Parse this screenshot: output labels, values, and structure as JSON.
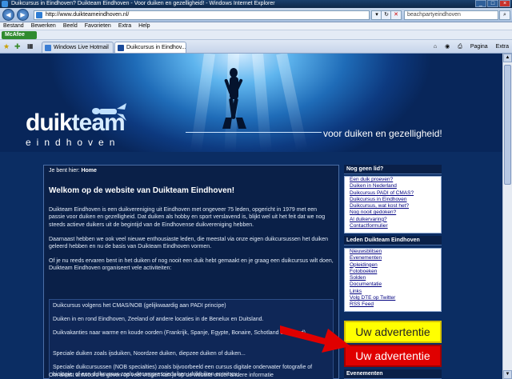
{
  "window": {
    "title": "Duikcursus in Eindhoven? Duikteam Eindhoven - Voor duiken en gezelligheid! - Windows Internet Explorer"
  },
  "addressbar": {
    "url": "http://www.duikteameindhoven.nl/",
    "search_text": "beachpartyeindhoven"
  },
  "menubar": {
    "items": [
      "Bestand",
      "Bewerken",
      "Beeld",
      "Favorieten",
      "Extra",
      "Help"
    ]
  },
  "linksbar": {
    "mcafee": "McAfee"
  },
  "tabs": [
    {
      "label": "Windows Live Hotmail",
      "active": false
    },
    {
      "label": "Duikcursus in Eindhov...",
      "active": true
    }
  ],
  "toolbar": {
    "page": "Pagina",
    "extra": "Extra"
  },
  "banner": {
    "logo_main": "duik",
    "logo_team": "team",
    "logo_sub": "eindhoven",
    "slogan": "voor duiken en gezelligheid!"
  },
  "content": {
    "breadcrumb_prefix": "Je bent hier: ",
    "breadcrumb_home": "Home",
    "heading": "Welkom op de website van Duikteam Eindhoven!",
    "para1": "Duikteam Eindhoven is een duikvereniging uit Eindhoven met ongeveer 75 leden, opgericht in 1979 met een passie voor duiken en gezelligheid. Dat duiken als hobby en sport verslavend is, blijkt wel uit het feit dat we nog steeds actieve duikers uit de begintijd van de Eindhovense duikvereniging hebben.",
    "para2": "Daarnaast hebben we ook veel nieuwe enthousiaste leden, die meestal via onze eigen duikcursussen het duiken geleerd hebben en nu de basis van Duikteam Eindhoven vormen.",
    "para3": "Of je nu reeds ervaren bent in het duiken of nog nooit een duik hebt gemaakt en je graag een duikcursus wilt doen, Duikteam Eindhoven organiseert vele activiteiten:",
    "activities": [
      "Duikcursus volgens het CMAS/NOB (gelijkwaardig aan PADI principe)",
      "Duiken in en rond Eindhoven, Zeeland of andere locaties in de Benelux en Duitsland.",
      "Duikvakanties naar warme en koude oorden (Frankrijk, Spanje, Egypte, Bonaire, Schotland of Ierland)",
      "Speciale duiken zoals ijsduiken, Noordzee duiken, diepzee duiken of duiken...",
      "Speciale duikcursussen (NOB specialties) zoals bijvoorbeeld een cursus digitale onderwater fotografie of biologie, of een duikcursus zoals decompressieduiken, drifduiken en nitrox."
    ],
    "para4": "Om alvast antwoord te geven op veel vragen kan je op de website onder andere informatie"
  },
  "sidebar": {
    "section1_title": "Nog geen lid?",
    "section1_links": [
      "Een duik proeven?",
      "Duiken in Nederland",
      "Duikcursus PADI of CMAS?",
      "Duikcursus in Eindhoven",
      "Duikcursus, wat kost het?",
      "Nog nooit gedoken?",
      "Al duikervaring?",
      "Contactformulier"
    ],
    "section2_title": "Leden Duikteam Eindhoven",
    "section2_links": [
      "Nieuwsblitsen",
      "Evenementen",
      "Opleidingen",
      "Fotoboeken",
      "Solden",
      "Documentatie",
      "Links",
      "Volg DTE op Twitter",
      "RSS Feed"
    ],
    "ad_yellow": "Uw advertentie",
    "ad_red": "Uw advertentie",
    "section3_title": "Evenementen"
  },
  "colors": {
    "page_bg": "#0b2d63",
    "ad_yellow": "#ffff00",
    "ad_red": "#e00000",
    "arrow": "#e00000"
  }
}
